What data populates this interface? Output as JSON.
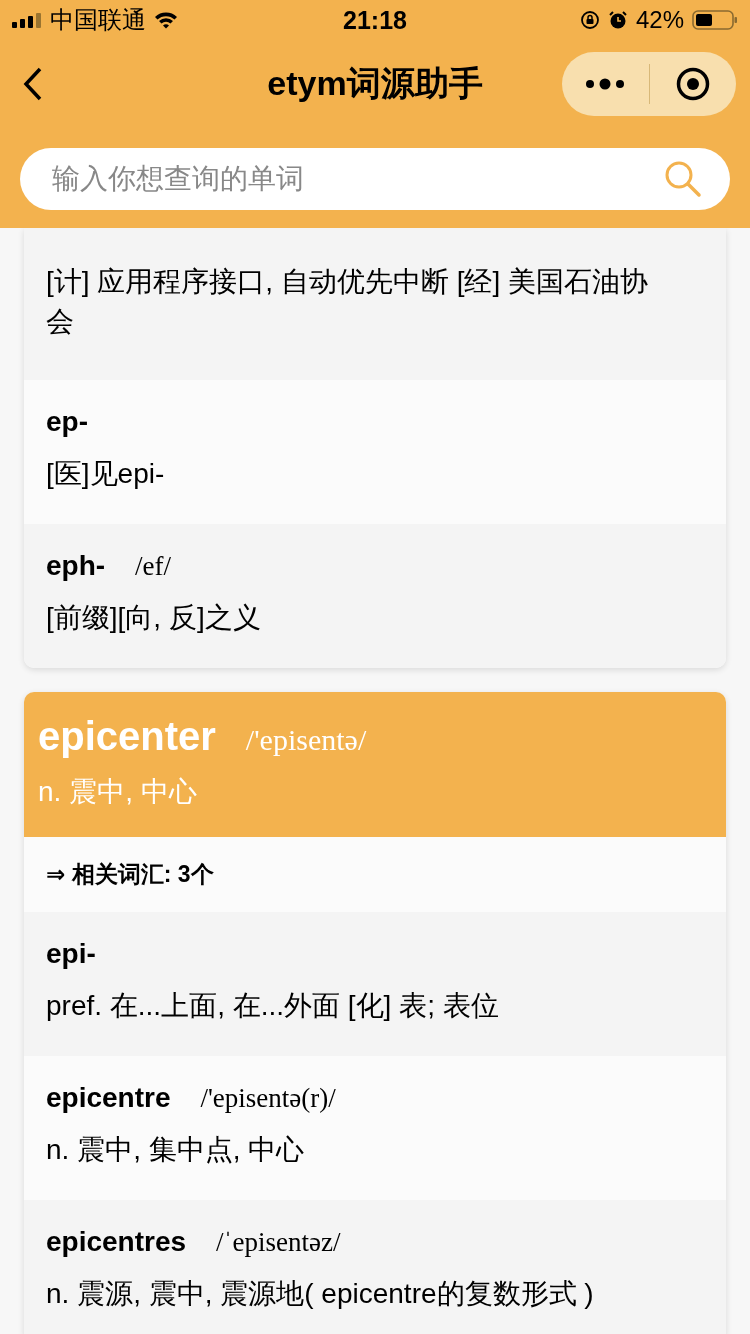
{
  "status_bar": {
    "carrier": "中国联通",
    "time": "21:18",
    "battery": "42%"
  },
  "nav": {
    "title": "etym词源助手"
  },
  "search": {
    "placeholder": "输入你想查询的单词"
  },
  "cards": [
    {
      "rows": [
        {
          "meaning": "[计] 应用程序接口, 自动优先中断 [经] 美国石油协会"
        },
        {
          "word": "ep-",
          "meaning": "[医]见epi-"
        },
        {
          "word": "eph-",
          "phonetic": "/ef/",
          "meaning": "[前缀][向, 反]之义"
        }
      ]
    },
    {
      "headword": {
        "word": "epicenter",
        "phonetic": "/'episentə/",
        "meaning": "n. 震中, 中心"
      },
      "related": "⇒ 相关词汇: 3个",
      "rows": [
        {
          "word": "epi-",
          "meaning": "pref. 在...上面, 在...外面 [化] 表; 表位"
        },
        {
          "word": "epicentre",
          "phonetic": "/'episentə(r)/",
          "meaning": "n. 震中, 集中点, 中心"
        },
        {
          "word": "epicentres",
          "phonetic": "/ˈepisentəz/",
          "meaning": "n. 震源, 震中, 震源地( epicentre的复数形式 )"
        }
      ]
    }
  ]
}
